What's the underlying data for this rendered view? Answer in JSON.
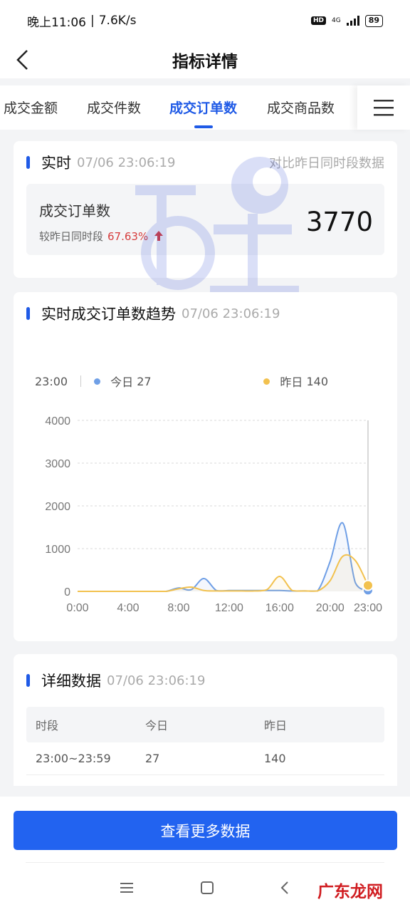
{
  "status_bar": {
    "time": "晚上11:06",
    "speed": "7.6K/s",
    "network_type": "4G",
    "battery": "89"
  },
  "header": {
    "title": "指标详情",
    "back_icon": "chevron-left-icon"
  },
  "tabs": [
    {
      "label": "成交金额",
      "active": false
    },
    {
      "label": "成交件数",
      "active": false
    },
    {
      "label": "成交订单数",
      "active": true
    },
    {
      "label": "成交商品数",
      "active": false
    }
  ],
  "realtime": {
    "title": "实时",
    "time": "07/06 23:06:19",
    "compare_link": "对比昨日同时段数据",
    "metric_name": "成交订单数",
    "compare_label": "较昨日同时段",
    "compare_pct": "67.63%",
    "value": "3770"
  },
  "trend": {
    "title": "实时成交订单数趋势",
    "time": "07/06 23:06:19",
    "legend": {
      "hour": "23:00",
      "today_label": "今日",
      "today_value": "27",
      "yesterday_label": "昨日",
      "yesterday_value": "140"
    }
  },
  "chart_data": {
    "type": "line",
    "x": [
      "0:00",
      "1:00",
      "2:00",
      "3:00",
      "4:00",
      "5:00",
      "6:00",
      "7:00",
      "8:00",
      "9:00",
      "10:00",
      "11:00",
      "12:00",
      "13:00",
      "14:00",
      "15:00",
      "16:00",
      "17:00",
      "18:00",
      "19:00",
      "20:00",
      "21:00",
      "22:00",
      "23:00"
    ],
    "x_ticks": [
      "0:00",
      "4:00",
      "8:00",
      "12:00",
      "16:00",
      "20:00",
      "23:00"
    ],
    "y_ticks": [
      "0",
      "1000",
      "2000",
      "3000",
      "4000"
    ],
    "ylim": [
      0,
      4000
    ],
    "series": [
      {
        "name": "今日",
        "color": "#6f9fe6",
        "values": [
          0,
          0,
          0,
          0,
          0,
          0,
          0,
          0,
          80,
          40,
          300,
          20,
          20,
          20,
          20,
          20,
          20,
          10,
          10,
          10,
          700,
          1600,
          200,
          27
        ]
      },
      {
        "name": "昨日",
        "color": "#f2c14e",
        "values": [
          0,
          0,
          0,
          0,
          0,
          0,
          0,
          0,
          60,
          100,
          20,
          10,
          10,
          10,
          10,
          40,
          350,
          20,
          10,
          10,
          250,
          820,
          720,
          140
        ]
      }
    ],
    "grid": true
  },
  "details": {
    "title": "详细数据",
    "time": "07/06 23:06:19",
    "columns": [
      "时段",
      "今日",
      "昨日"
    ],
    "rows": [
      [
        "23:00~23:59",
        "27",
        "140"
      ]
    ]
  },
  "footer": {
    "cta_label": "查看更多数据",
    "watermark": "广东龙网"
  },
  "colors": {
    "accent": "#1f5ae6",
    "today": "#6f9fe6",
    "yesterday": "#f2c14e",
    "increase": "#d63c3c"
  }
}
